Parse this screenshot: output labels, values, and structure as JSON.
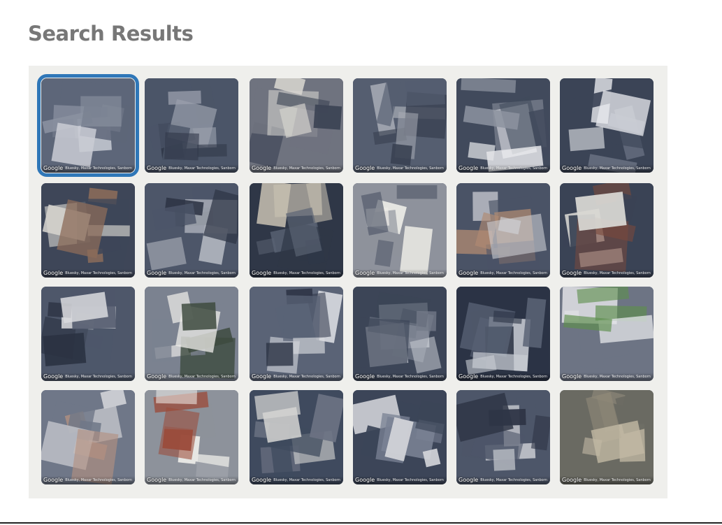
{
  "page": {
    "title": "Search Results"
  },
  "attribution": {
    "logo": "Google",
    "credits": "Bluesky, Maxar Technologies, Sanborn"
  },
  "results": [
    {
      "palette": [
        "#5d6679",
        "#c9ccd4",
        "#8a91a0"
      ],
      "selected": true
    },
    {
      "palette": [
        "#4b5568",
        "#9aa0ad",
        "#2f3747"
      ],
      "selected": false
    },
    {
      "palette": [
        "#6f737f",
        "#d8d6d0",
        "#3d4455"
      ],
      "selected": false
    },
    {
      "palette": [
        "#555e70",
        "#a9adb6",
        "#3a4252"
      ],
      "selected": false
    },
    {
      "palette": [
        "#414a5c",
        "#e3e4e8",
        "#8d93a0"
      ],
      "selected": false
    },
    {
      "palette": [
        "#3b4456",
        "#e9eaee",
        "#6c7385"
      ],
      "selected": false
    },
    {
      "palette": [
        "#3e4658",
        "#d7d5cf",
        "#8b6c5a"
      ],
      "selected": false
    },
    {
      "palette": [
        "#4d5669",
        "#b7bbc4",
        "#2e3545"
      ],
      "selected": false
    },
    {
      "palette": [
        "#2f3747",
        "#c7c0b1",
        "#5a6374"
      ],
      "selected": false
    },
    {
      "palette": [
        "#8e929c",
        "#ecebe6",
        "#4d5566"
      ],
      "selected": false
    },
    {
      "palette": [
        "#4a5366",
        "#b08a72",
        "#cfd1d6"
      ],
      "selected": false
    },
    {
      "palette": [
        "#3a4355",
        "#7a4a3c",
        "#d9d8d3"
      ],
      "selected": false
    },
    {
      "palette": [
        "#4e576a",
        "#d9dadd",
        "#2b3242"
      ],
      "selected": false
    },
    {
      "palette": [
        "#7b8290",
        "#ecebe7",
        "#3d4a3e"
      ],
      "selected": false
    },
    {
      "palette": [
        "#5a6376",
        "#d7d9de",
        "#2e3546"
      ],
      "selected": false
    },
    {
      "palette": [
        "#3c4557",
        "#c8cbd2",
        "#747b8a"
      ],
      "selected": false
    },
    {
      "palette": [
        "#2b3345",
        "#5b6477",
        "#c9ccd3"
      ],
      "selected": false
    },
    {
      "palette": [
        "#6d7484",
        "#e4e5e8",
        "#5e8f4e"
      ],
      "selected": false
    },
    {
      "palette": [
        "#6f7788",
        "#d5d6da",
        "#b39080"
      ],
      "selected": false
    },
    {
      "palette": [
        "#8d929b",
        "#efeeea",
        "#9b4c3b"
      ],
      "selected": false
    },
    {
      "palette": [
        "#3f4a5e",
        "#d4d4d2",
        "#6b7283"
      ],
      "selected": false
    },
    {
      "palette": [
        "#3c4558",
        "#7a8294",
        "#d7d8dc"
      ],
      "selected": false
    },
    {
      "palette": [
        "#4d5669",
        "#cfd1d6",
        "#2e3546"
      ],
      "selected": false
    },
    {
      "palette": [
        "#6a6a62",
        "#8e8878",
        "#c2b9a4"
      ],
      "selected": false
    }
  ]
}
